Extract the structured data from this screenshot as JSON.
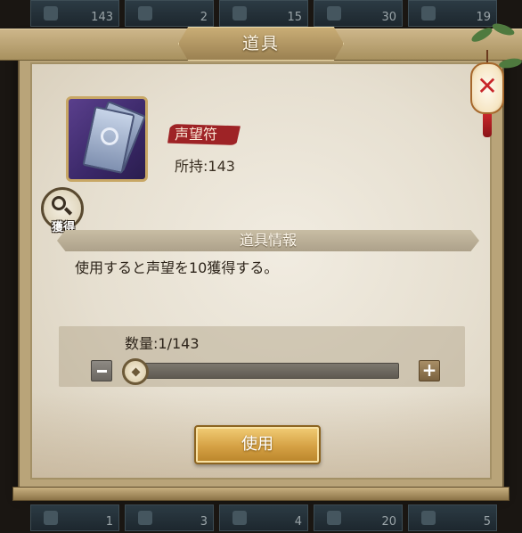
{
  "background_grid": {
    "top_counts": [
      "143",
      "2",
      "15",
      "30",
      "19"
    ],
    "bottom_counts": [
      "1",
      "3",
      "4",
      "20",
      "5"
    ]
  },
  "dialog": {
    "title": "道具",
    "item": {
      "name": "声望符",
      "owned_label": "所持:143",
      "icon": "talisman-icon"
    },
    "acquire_label": "獲得",
    "info_header": "道具情報",
    "description": "使用すると声望を10獲得する。",
    "quantity": {
      "label": "数量:1/143",
      "current": 1,
      "max": 143
    },
    "minus_icon": "minus-icon",
    "plus_label": "+",
    "use_button": "使用"
  },
  "colors": {
    "accent_gold": "#d5a144",
    "name_badge_red": "#9e2326",
    "panel_bg": "#ece6d8"
  }
}
